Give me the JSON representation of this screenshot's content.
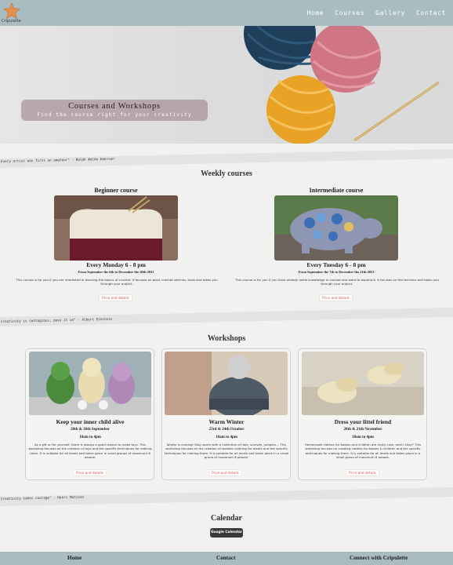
{
  "header": {
    "logo_text": "Cripulette",
    "nav": [
      "Home",
      "Courses",
      "Gallery",
      "Contact"
    ]
  },
  "hero": {
    "title": "Courses and Workshops",
    "subtitle": "Find the course right for your creativity"
  },
  "quotes": [
    "Every artist was first an amateur\" - Ralph Waldo Emerson",
    "Creativity is contagious, pass it on\" - Albert Einstein",
    "Creativity takes courage\" - Henri Matisse"
  ],
  "weekly": {
    "title": "Weekly courses",
    "courses": [
      {
        "title": "Beginner course",
        "schedule": "Every Monday 6 - 8 pm",
        "dates": "From September the 6th to December the 20th 2021",
        "desc": "This course is for you if you are interested in learning the basics of crochet. It focuses on basic crochet stitches, tools and takes you through your project.",
        "button": "Price and details"
      },
      {
        "title": "Intermediate course",
        "schedule": "Every Tuesday 6 - 8 pm",
        "dates": "From September the 7th to December the 21th 2021",
        "desc": "This course is for you if you have already some knowledge in crochet and want to expand it. It focuses on the technics and takes you through your project.",
        "button": "Price and details"
      }
    ]
  },
  "workshops": {
    "title": "Workshops",
    "items": [
      {
        "title": "Keep your inner child alive",
        "dates": "20th & 26th September",
        "time": "10am to 4pm",
        "desc": "As a gift or for yourself, there is always a good reason to make toys. This workshop focuses on the creation of toys and the specific techniques for making them. It is suitable for all levels and takes place in small groups of maximum 6 people.",
        "button": "Price and details"
      },
      {
        "title": "Warm Winter",
        "dates": "23rd & 24th October",
        "time": "10am to 4pm",
        "desc": "Winter is coming! Stay warm with a collection of hats, scarves, jumpers... This workshop focuses on the creation of woollen clothing for adults and the specific techniques for making them. It is suitable for all levels and takes place in a small group of maximum 6 people.",
        "button": "Price and details"
      },
      {
        "title": "Dress your littel friend",
        "dates": "20th & 21th November",
        "time": "10am to 4pm",
        "desc": "Homemade clothes for babies and children are really cute, aren't they? This workshop focuses on creating clothes for babies & children and the specific techniques for making them. It is suitable for all levels and takes place in a small group of maximum 6 people.",
        "button": "Price and details"
      }
    ]
  },
  "calendar": {
    "title": "Calendar",
    "button": "Google Calendar"
  },
  "footer": {
    "home": "Home",
    "contact": "Contact",
    "connect": "Connect with Cripulette"
  },
  "colors": {
    "header_bg": "#a9bcc2",
    "accent": "#d05555",
    "banner": "#967982"
  }
}
